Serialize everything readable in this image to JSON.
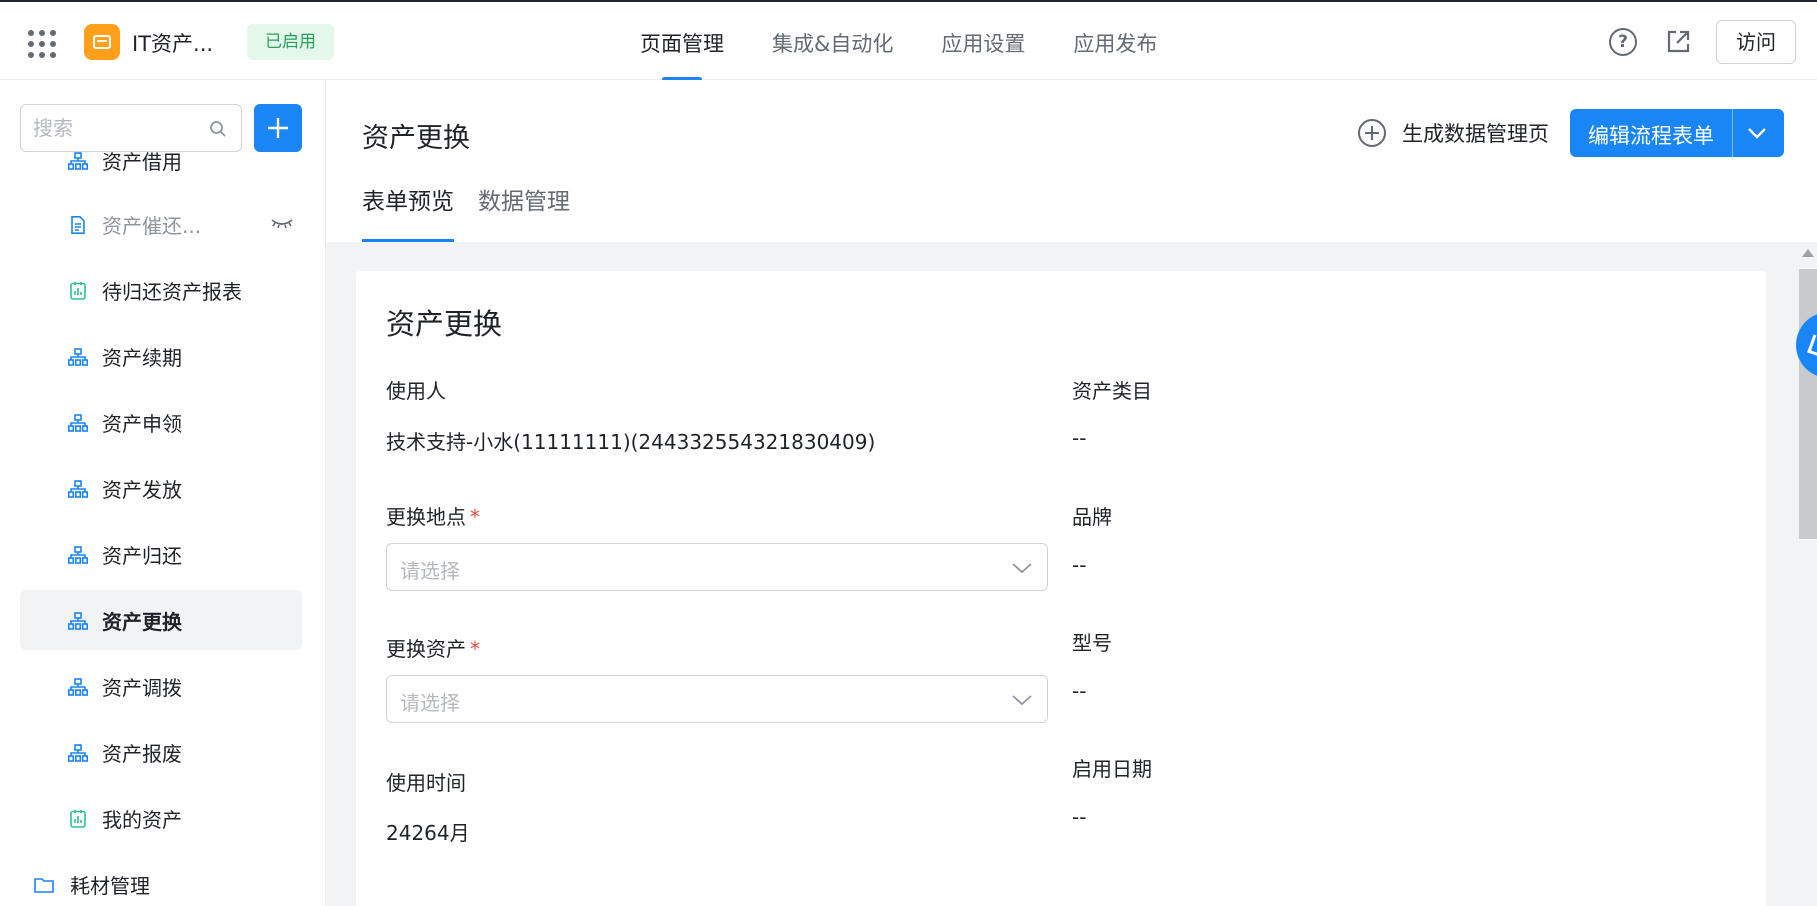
{
  "header": {
    "app_name": "IT资产...",
    "status": "已启用",
    "nav": [
      "页面管理",
      "集成&自动化",
      "应用设置",
      "应用发布"
    ],
    "visit_label": "访问",
    "help_glyph": "?"
  },
  "sidebar": {
    "search_placeholder": "搜索",
    "items": [
      {
        "label": "资产借用",
        "icon": "flow-icon"
      },
      {
        "label": "资产催还...",
        "icon": "document-icon",
        "hidden": true
      },
      {
        "label": "待归还资产报表",
        "icon": "report-icon"
      },
      {
        "label": "资产续期",
        "icon": "flow-icon"
      },
      {
        "label": "资产申领",
        "icon": "flow-icon"
      },
      {
        "label": "资产发放",
        "icon": "flow-icon"
      },
      {
        "label": "资产归还",
        "icon": "flow-icon"
      },
      {
        "label": "资产更换",
        "icon": "flow-icon",
        "active": true
      },
      {
        "label": "资产调拨",
        "icon": "flow-icon"
      },
      {
        "label": "资产报废",
        "icon": "flow-icon"
      },
      {
        "label": "我的资产",
        "icon": "report-icon"
      },
      {
        "label": "耗材管理",
        "icon": "folder-icon"
      }
    ]
  },
  "main": {
    "page_title": "资产更换",
    "generate_label": "生成数据管理页",
    "edit_label": "编辑流程表单",
    "tabs": [
      "表单预览",
      "数据管理"
    ],
    "form": {
      "title": "资产更换",
      "user_label": "使用人",
      "user_value": "技术支持-小水(11111111)(244332554321830409)",
      "location_label": "更换地点",
      "location_placeholder": "请选择",
      "asset_label": "更换资产",
      "asset_placeholder": "请选择",
      "time_label": "使用时间",
      "time_value": "24264月",
      "category_label": "资产类目",
      "category_value": "--",
      "brand_label": "品牌",
      "brand_value": "--",
      "model_label": "型号",
      "model_value": "--",
      "start_label": "启用日期",
      "start_value": "--",
      "required_mark": "*"
    }
  },
  "colors": {
    "accent": "#1a86f5",
    "status_bg": "#e3f7ea",
    "status_text": "#26a15a",
    "logo": "#ff9f1a",
    "flow_icon": "#1a86f5",
    "report_icon": "#2bc48a"
  }
}
